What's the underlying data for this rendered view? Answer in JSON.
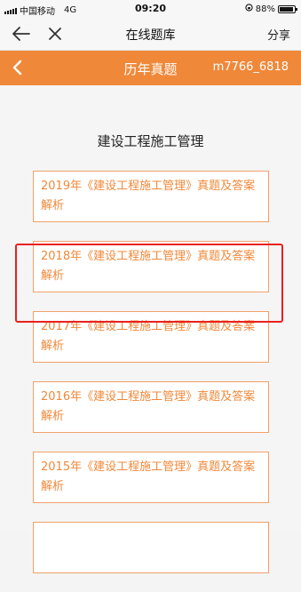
{
  "status_bar": {
    "carrier": "中国移动",
    "network": "4G",
    "time": "09:20",
    "battery": "88%"
  },
  "nav_bar": {
    "title": "在线题库",
    "share_label": "分享"
  },
  "header": {
    "title": "历年真题",
    "code": "m7766_6818",
    "background": "#f0883a"
  },
  "section_title": "建设工程施工管理",
  "items": [
    {
      "label": "2019年《建设工程施工管理》真题及答案解析"
    },
    {
      "label": "2018年《建设工程施工管理》真题及答案解析"
    },
    {
      "label": "2017年《建设工程施工管理》真题及答案解析"
    },
    {
      "label": "2016年《建设工程施工管理》真题及答案解析"
    },
    {
      "label": "2015年《建设工程施工管理》真题及答案解析"
    }
  ],
  "colors": {
    "accent": "#f0883a",
    "highlight": "#e8221e"
  }
}
